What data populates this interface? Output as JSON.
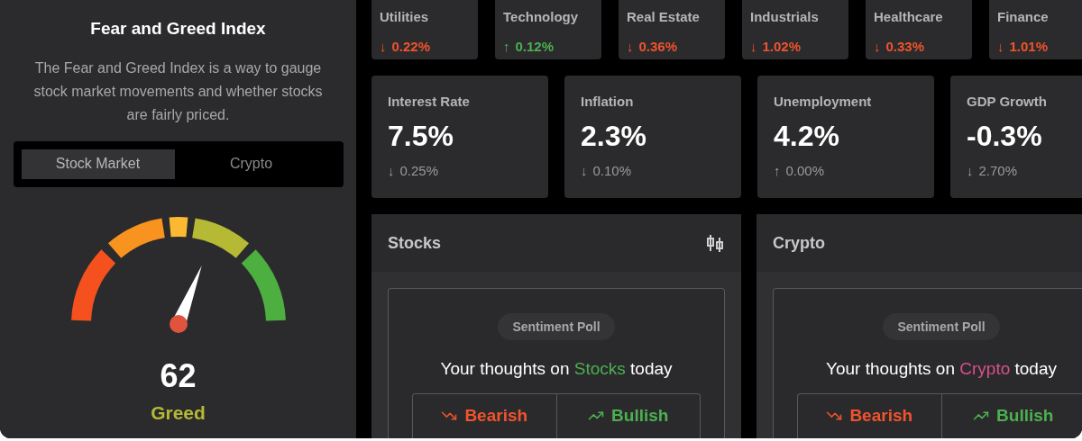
{
  "gauge_panel": {
    "title": "Fear and Greed Index",
    "description": "The Fear and Greed Index is a way to gauge stock market movements and whether stocks are fairly priced.",
    "tabs": [
      {
        "label": "Stock Market",
        "selected": true
      },
      {
        "label": "Crypto",
        "selected": false
      }
    ],
    "gauge": {
      "value": "62",
      "rating": "Greed"
    }
  },
  "sectors": [
    {
      "name": "Utilities",
      "arrow": "↓",
      "change": "0.22%",
      "color": "#f0532d"
    },
    {
      "name": "Technology",
      "arrow": "↑",
      "change": "0.12%",
      "color": "#4caf50"
    },
    {
      "name": "Real Estate",
      "arrow": "↓",
      "change": "0.36%",
      "color": "#f0532d"
    },
    {
      "name": "Industrials",
      "arrow": "↓",
      "change": "1.02%",
      "color": "#f0532d"
    },
    {
      "name": "Healthcare",
      "arrow": "↓",
      "change": "0.33%",
      "color": "#f0532d"
    },
    {
      "name": "Finance",
      "arrow": "↓",
      "change": "1.01%",
      "color": "#f0532d"
    }
  ],
  "indicators": [
    {
      "name": "Interest Rate",
      "value": "7.5%",
      "arrow": "↓",
      "change": "0.25%"
    },
    {
      "name": "Inflation",
      "value": "2.3%",
      "arrow": "↓",
      "change": "0.10%"
    },
    {
      "name": "Unemployment",
      "value": "4.2%",
      "arrow": "↑",
      "change": "0.00%"
    },
    {
      "name": "GDP Growth",
      "value": "-0.3%",
      "arrow": "↓",
      "change": "2.70%"
    }
  ],
  "panels": [
    {
      "title": "Stocks",
      "chart_icon": true,
      "poll_label": "Sentiment Poll",
      "question_before": "Your thoughts on ",
      "question_subject": "Stocks",
      "question_after": " today",
      "color": "#4caf50",
      "buttons": [
        "Bearish",
        "Bullish"
      ]
    },
    {
      "title": "Crypto",
      "chart_icon": false,
      "poll_label": "Sentiment Poll",
      "question_before": "Your thoughts on ",
      "question_subject": "Crypto",
      "question_after": " today",
      "color": "#d9508a",
      "buttons": [
        "Bearish",
        "Bullish"
      ]
    }
  ]
}
